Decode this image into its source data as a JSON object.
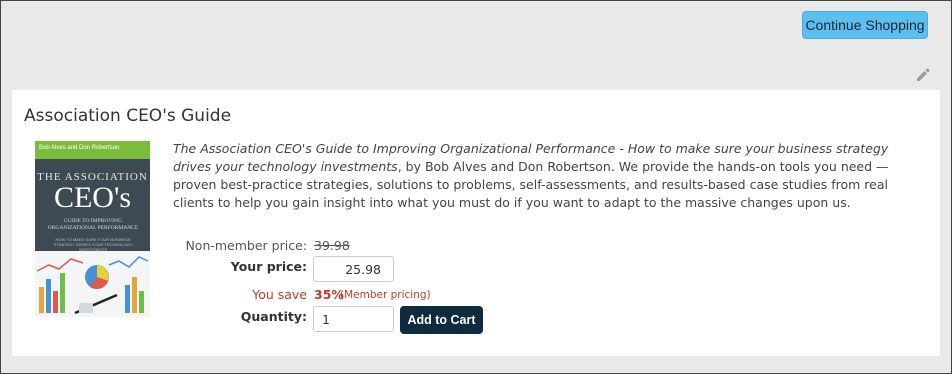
{
  "toolbar": {
    "continue_label": "Continue Shopping",
    "edit_icon": "pencil-icon"
  },
  "product": {
    "title": "Association CEO's Guide",
    "cover": {
      "authors": "Bob Alves and Don Robertson",
      "line1": "THE ASSOCIATION",
      "line2": "CEO's",
      "subtitle": "GUIDE TO IMPROVING ORGANIZATIONAL PERFORMANCE",
      "tagline": "HOW TO MAKE SURE YOUR BUSINESS STRATEGY DRIVES YOUR TECHNOLOGY INVESTMENTS",
      "colors": {
        "band": "#7bbd3a",
        "background": "#3d4a54"
      }
    },
    "description": {
      "italic": "The Association CEO's Guide to Improving Organizational Performance - How to make sure your business strategy drives your technology investments",
      "rest": ", by Bob Alves and Don Robertson. We provide the hands-on tools you need — proven best-practice strategies, solutions to problems, self-assessments, and results-based case studies from real clients to help you gain insight into what you must do if you want to adapt to the massive changes upon us."
    }
  },
  "pricing": {
    "nonmember_label": "Non-member price:",
    "nonmember_value": "39.98",
    "your_price_label": "Your price:",
    "your_price_value": "25.98",
    "you_save_label": "You save",
    "you_save_value": "35%",
    "you_save_note": "(Member pricing)",
    "quantity_label": "Quantity:",
    "quantity_value": "1",
    "add_to_cart_label": "Add to Cart"
  },
  "colors": {
    "accent_button": "#5bc0ef",
    "cart_button": "#0e2b3f",
    "save_red": "#c0392b"
  }
}
